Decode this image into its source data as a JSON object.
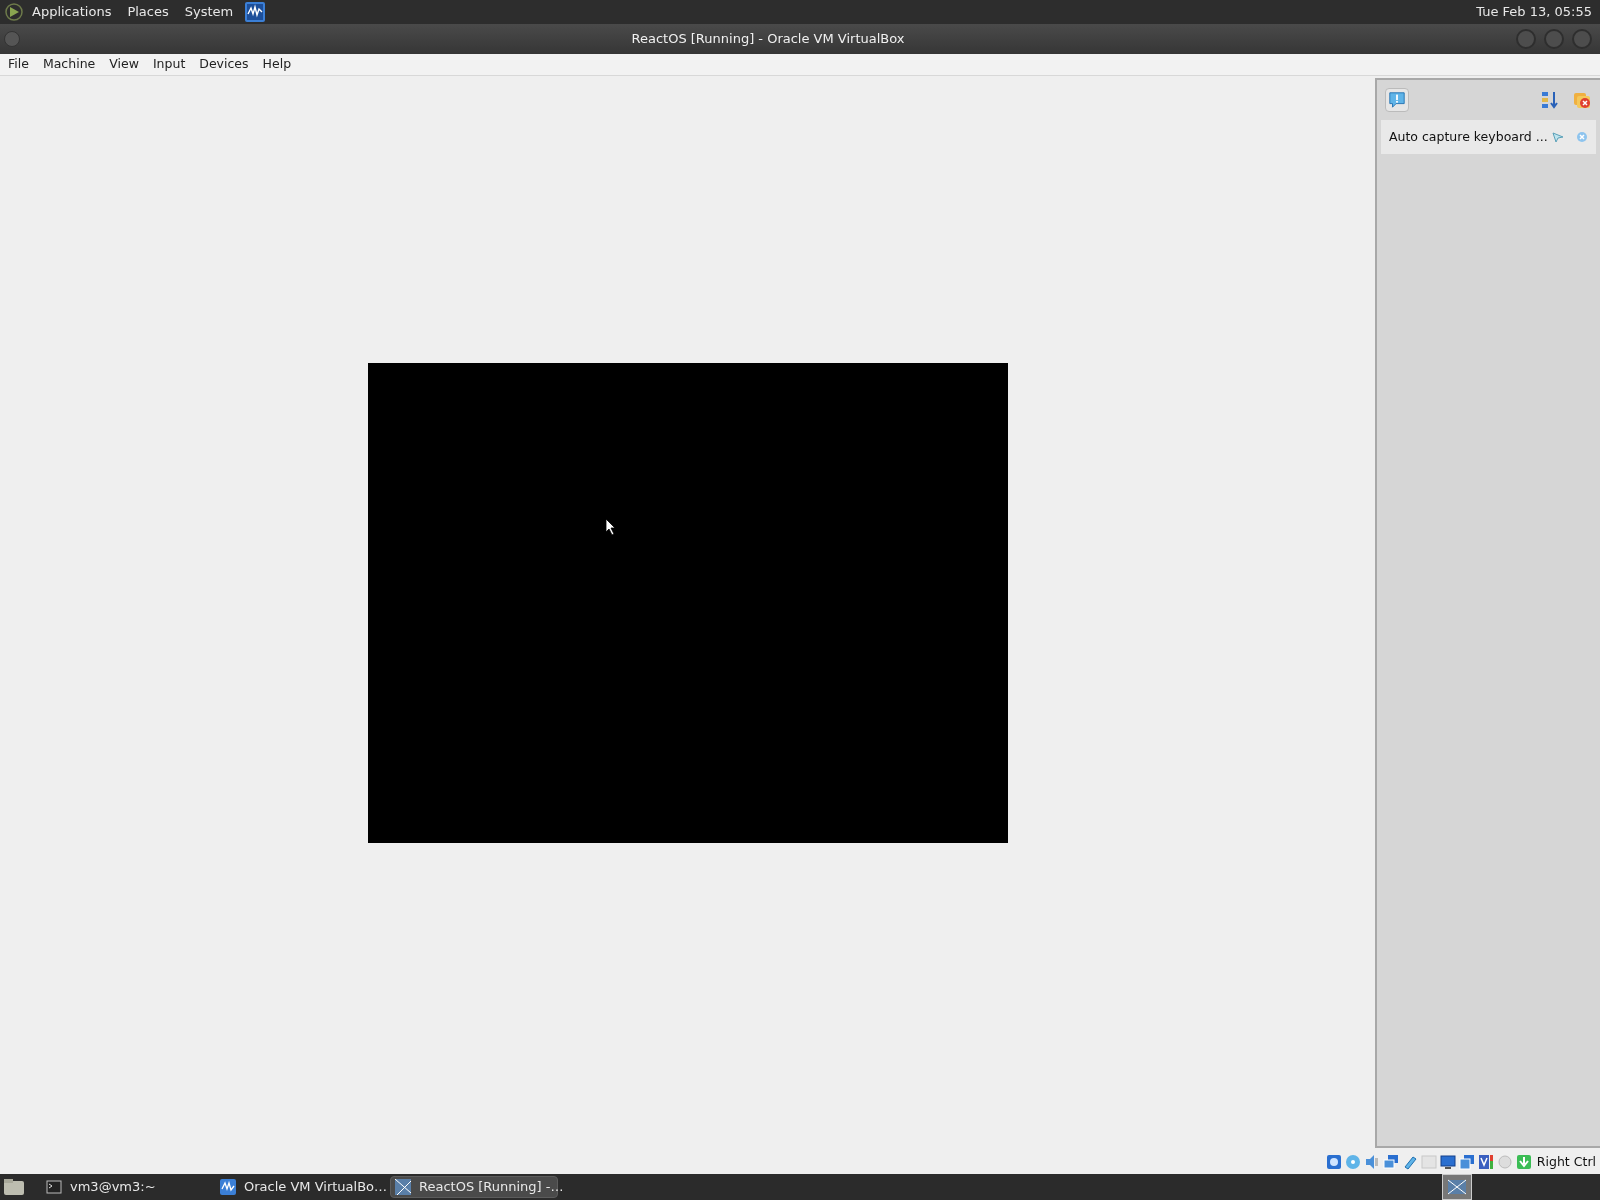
{
  "top_panel": {
    "menus": [
      "Applications",
      "Places",
      "System"
    ],
    "clock": "Tue Feb 13, 05:55"
  },
  "window": {
    "title": "ReactOS [Running] - Oracle VM VirtualBox"
  },
  "menu_bar": [
    "File",
    "Machine",
    "View",
    "Input",
    "Devices",
    "Help"
  ],
  "notification_center": {
    "messages": [
      "Auto capture keyboard ..."
    ]
  },
  "status_bar": {
    "host_key": "Right Ctrl"
  },
  "taskbar": [
    {
      "kind": "terminal",
      "label": "vm3@vm3:~",
      "selected": false
    },
    {
      "kind": "virtualbox",
      "label": "Oracle VM VirtualBo…",
      "selected": false
    },
    {
      "kind": "vm",
      "label": "ReactOS [Running] -…",
      "selected": true
    }
  ]
}
